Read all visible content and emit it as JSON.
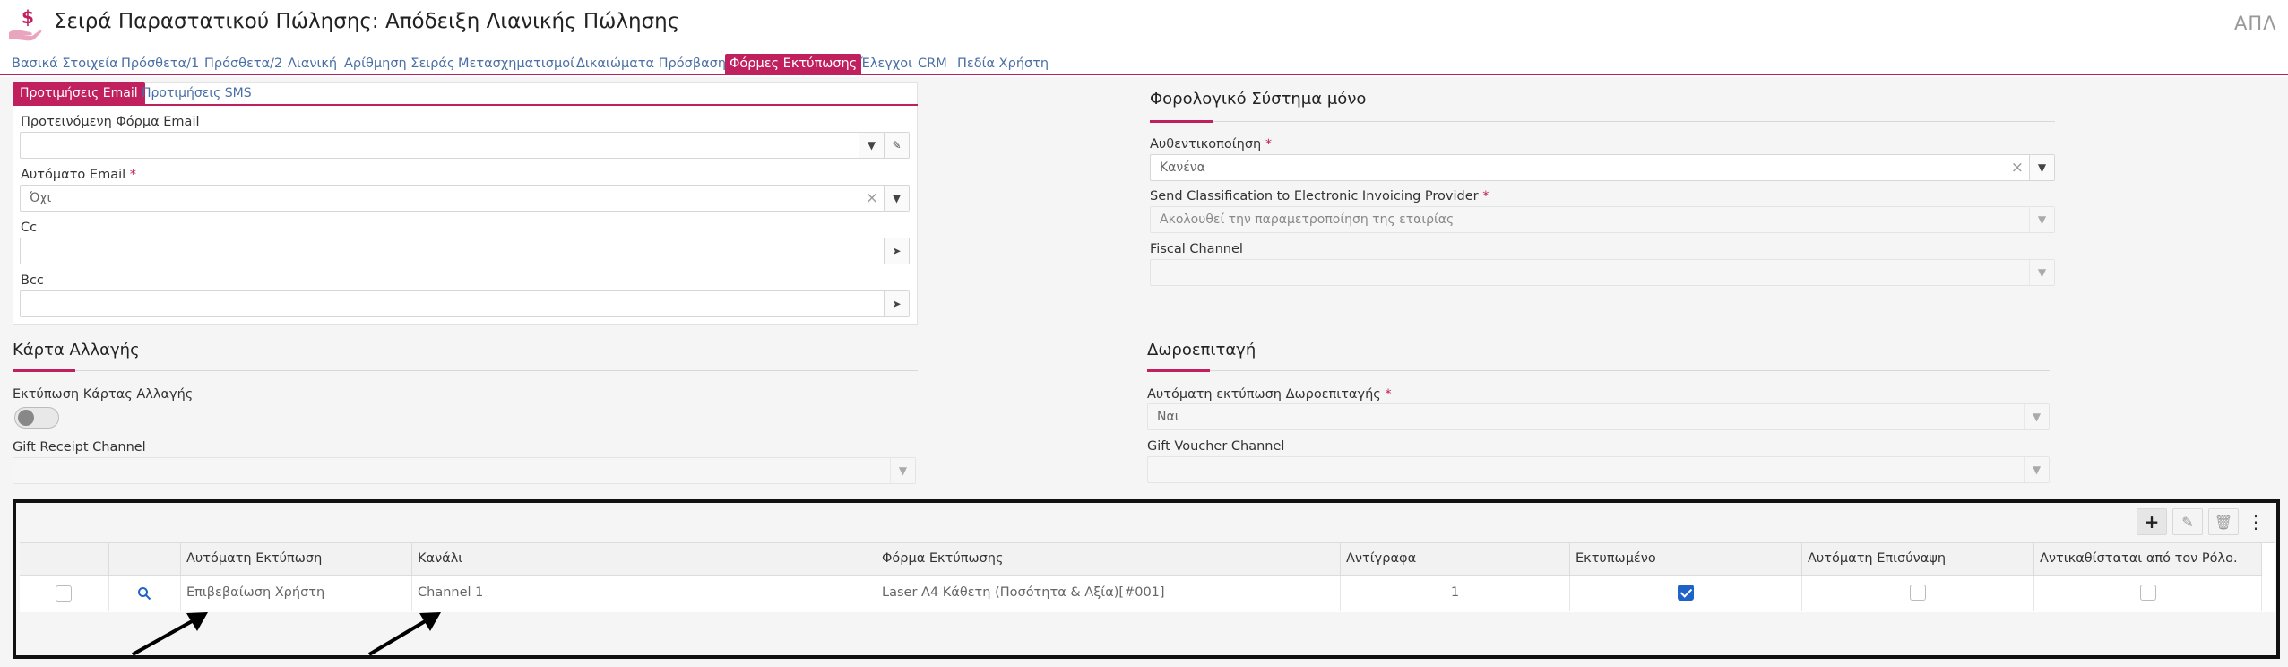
{
  "header": {
    "title": "Σειρά Παραστατικού Πώλησης: Απόδειξη Λιανικής Πώλησης",
    "right_text": "ΑΠΛ",
    "icon": "hand-dollar-icon"
  },
  "tabs": [
    "Βασικά Στοιχεία",
    "Πρόσθετα/1",
    "Πρόσθετα/2",
    "Λιανική",
    "Αρίθμηση Σειράς",
    "Μετασχηματισμοί",
    "Δικαιώματα Πρόσβασης",
    "Φόρμες Εκτύπωσης",
    "Έλεγχοι",
    "CRM",
    "Πεδία Χρήστη"
  ],
  "active_tab": "Φόρμες Εκτύπωσης",
  "email_section": {
    "subtabs": [
      "Προτιμήσεις Email",
      "Προτιμήσεις SMS"
    ],
    "suggested_form_label": "Προτεινόμενη Φόρμα Email",
    "suggested_form_value": "",
    "auto_email_label": "Αυτόματο Email",
    "auto_email_value": "Όχι",
    "cc_label": "Cc",
    "cc_value": "",
    "bcc_label": "Bcc",
    "bcc_value": "",
    "required_mark": "*"
  },
  "fiscal_section": {
    "title": "Φορολογικό Σύστημα μόνο",
    "auth_label": "Αυθεντικοποίηση",
    "auth_value": "Κανένα",
    "send_class_label": "Send Classification to Electronic Invoicing Provider",
    "send_class_value": "Ακολουθεί την παραμετροποίηση της εταιρίας",
    "fiscal_channel_label": "Fiscal Channel",
    "fiscal_channel_value": ""
  },
  "change_card_section": {
    "title": "Κάρτα Αλλαγής",
    "print_label": "Εκτύπωση Κάρτας Αλλαγής",
    "gift_receipt_label": "Gift Receipt Channel",
    "gift_receipt_value": ""
  },
  "gift_voucher_section": {
    "title": "Δωροεπιταγή",
    "auto_print_label": "Αυτόματη εκτύπωση Δωροεπιταγής",
    "auto_print_value": "Ναι",
    "gift_voucher_channel_label": "Gift Voucher Channel",
    "gift_voucher_channel_value": ""
  },
  "grid": {
    "columns": [
      "Αυτόματη Εκτύπωση",
      "Κανάλι",
      "Φόρμα Εκτύπωσης",
      "Αντίγραφα",
      "Εκτυπωμένο",
      "Αυτόματη Επισύναψη",
      "Αντικαθίσταται από τον Ρόλο."
    ],
    "rows": [
      {
        "auto_print": "Επιβεβαίωση Χρήστη",
        "channel": "Channel 1",
        "print_form": "Laser A4 Κάθετη (Ποσότητα & Αξία)[#001]",
        "copies": "1",
        "printed": true,
        "auto_attach": false,
        "role_override": false
      }
    ]
  },
  "colors": {
    "accent": "#c0205d",
    "link": "#4a6fa5",
    "checkbox_on": "#1f63c9"
  }
}
